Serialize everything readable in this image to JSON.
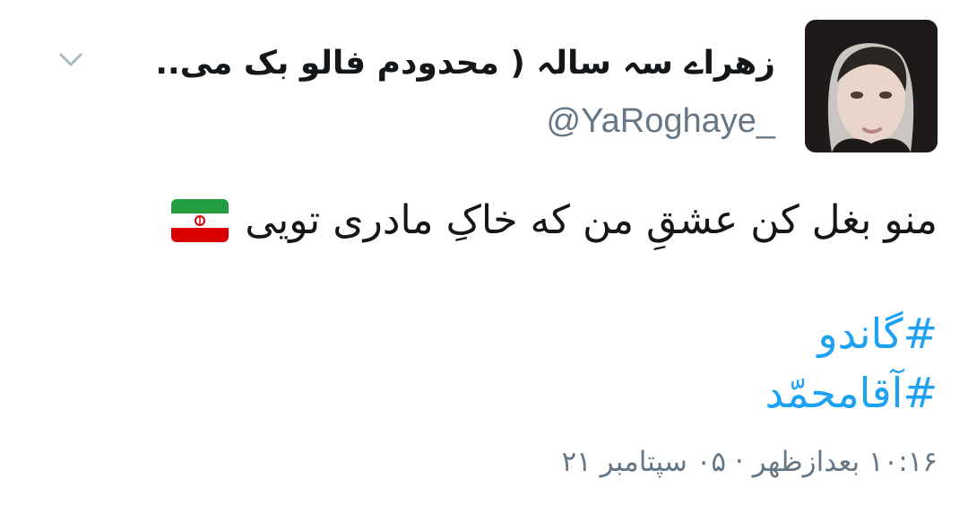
{
  "tweet": {
    "display_name": "زهراے سہ سالہ ( محدودم فالو بک می..",
    "handle": "@YaRoghaye_",
    "text": "منو بغل کن عشقِ من که خاکِ مادری تویی",
    "hashtags": [
      "#گاندو",
      "#آقامحمّد"
    ],
    "timestamp": "۱۰:۱۶ بعدازظهر · ۰۵ سپتامبر ۲۱"
  },
  "icons": {
    "menu": "chevron-down-icon",
    "flag": "iran-flag-emoji"
  },
  "colors": {
    "link": "#1da1f2",
    "secondary_text": "#657786",
    "primary_text": "#14171a",
    "background": "#ffffff"
  }
}
